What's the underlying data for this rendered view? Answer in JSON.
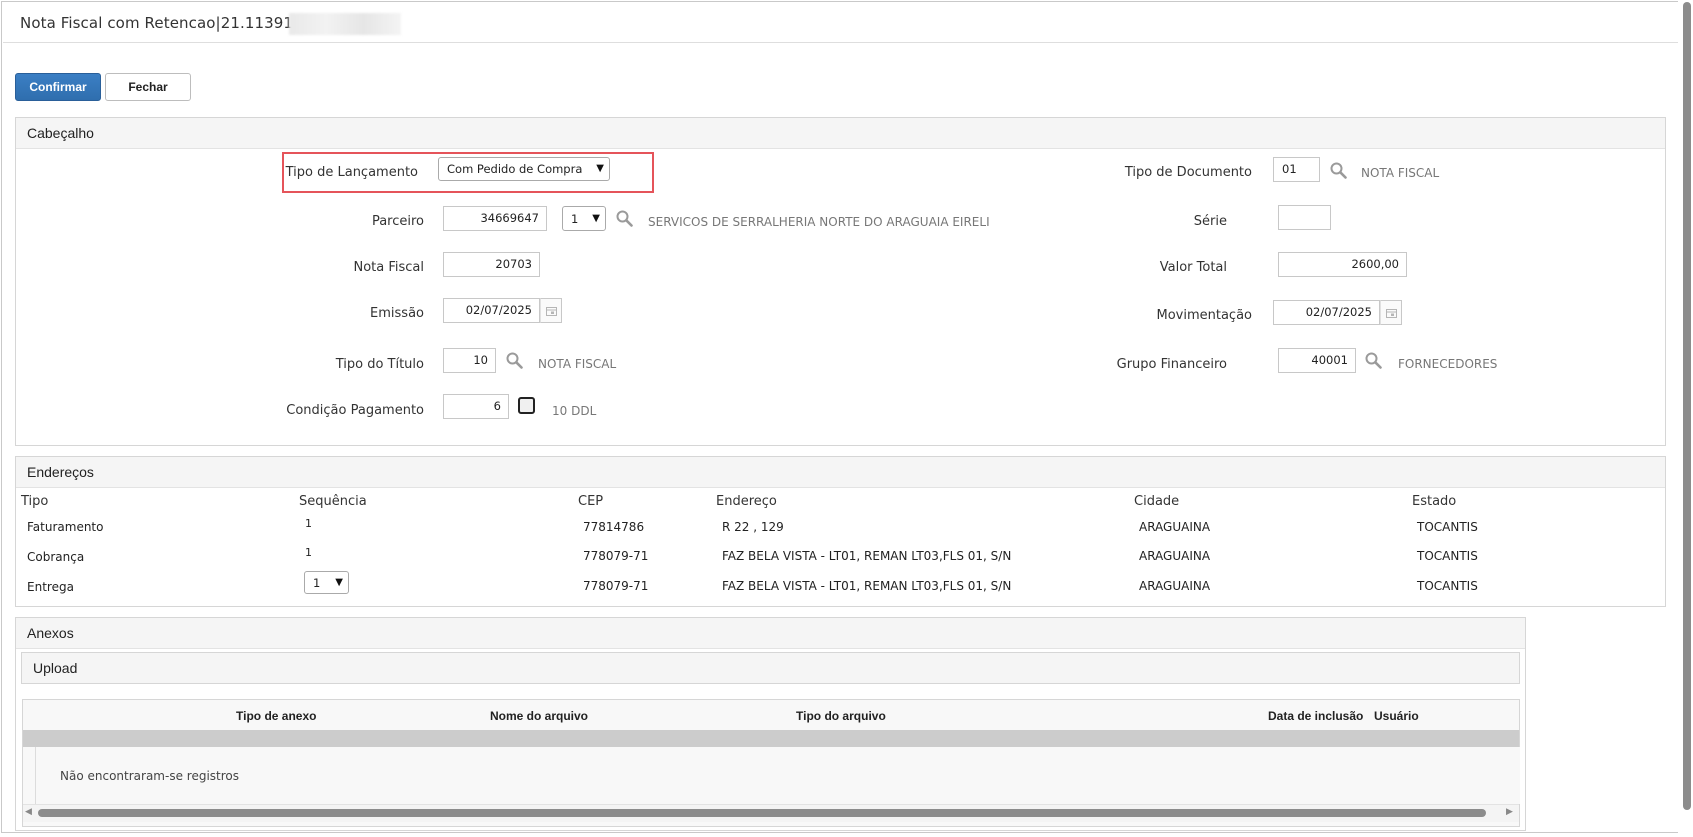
{
  "window": {
    "title": "Nota Fiscal com Retencao|21.113913|"
  },
  "toolbar": {
    "confirm_label": "Confirmar",
    "close_label": "Fechar"
  },
  "cabecalho": {
    "title": "Cabeçalho",
    "tipo_lancamento": {
      "label": "Tipo de Lançamento",
      "value": "Com Pedido de Compra"
    },
    "parceiro": {
      "label": "Parceiro",
      "code": "34669647",
      "seq": "1",
      "name": "SERVICOS DE SERRALHERIA NORTE DO ARAGUAIA EIRELI"
    },
    "nota_fiscal": {
      "label": "Nota Fiscal",
      "value": "20703"
    },
    "emissao": {
      "label": "Emissão",
      "value": "02/07/2025"
    },
    "tipo_titulo": {
      "label": "Tipo do Título",
      "value": "10",
      "desc": "NOTA FISCAL"
    },
    "condicao_pagamento": {
      "label": "Condição Pagamento",
      "value": "6",
      "desc": "10 DDL"
    },
    "tipo_documento": {
      "label": "Tipo de Documento",
      "value": "01",
      "desc": "NOTA FISCAL"
    },
    "serie": {
      "label": "Série",
      "value": ""
    },
    "valor_total": {
      "label": "Valor Total",
      "value": "2600,00"
    },
    "movimentacao": {
      "label": "Movimentação",
      "value": "02/07/2025"
    },
    "grupo_financeiro": {
      "label": "Grupo Financeiro",
      "value": "40001",
      "desc": "FORNECEDORES"
    }
  },
  "enderecos": {
    "title": "Endereços",
    "columns": [
      "Tipo",
      "Sequência",
      "CEP",
      "Endereço",
      "Cidade",
      "Estado"
    ],
    "rows": [
      {
        "tipo": "Faturamento",
        "seq": "1",
        "cep": "77814786",
        "endereco": "R 22 , 129",
        "cidade": "ARAGUAINA",
        "estado": "TOCANTIS"
      },
      {
        "tipo": "Cobrança",
        "seq": "1",
        "cep": "778079-71",
        "endereco": "FAZ BELA VISTA - LT01, REMAN LT03,FLS 01, S/N",
        "cidade": "ARAGUAINA",
        "estado": "TOCANTIS"
      },
      {
        "tipo": "Entrega",
        "seq": "1",
        "cep": "778079-71",
        "endereco": "FAZ BELA VISTA - LT01, REMAN LT03,FLS 01, S/N",
        "cidade": "ARAGUAINA",
        "estado": "TOCANTIS"
      }
    ]
  },
  "anexos": {
    "title": "Anexos",
    "upload_title": "Upload",
    "columns": [
      "Tipo de anexo",
      "Nome do arquivo",
      "Tipo do arquivo",
      "Data de inclusão",
      "Usuário"
    ],
    "empty_message": "Não encontraram-se registros"
  },
  "colors": {
    "primary": "#2f6eae",
    "highlight": "#e5545a",
    "panel_header": "#f5f5f5"
  }
}
